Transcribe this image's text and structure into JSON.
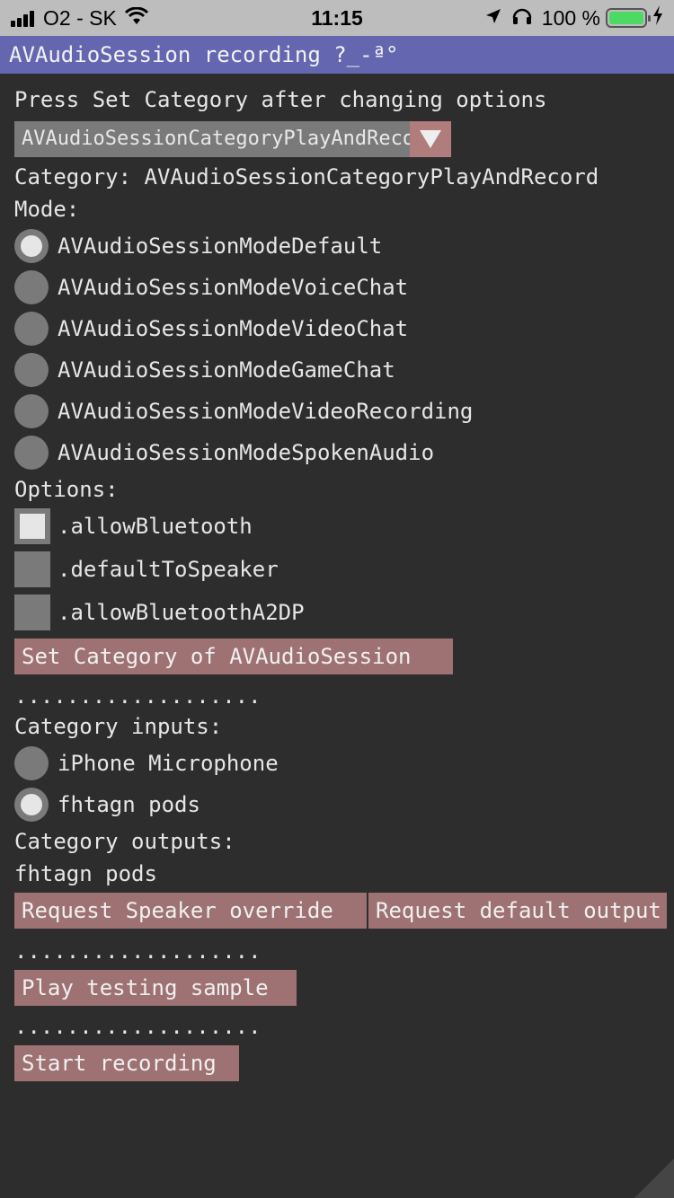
{
  "status_bar": {
    "carrier": "O2 - SK",
    "time": "11:15",
    "battery": "100 %",
    "battery_level": 1.0,
    "icons": [
      "signal-icon",
      "wifi-icon",
      "location-arrow-icon",
      "headphones-icon",
      "battery-icon",
      "charging-bolt-icon"
    ]
  },
  "window": {
    "title": "AVAudioSession recording ?_-ª°"
  },
  "main": {
    "instructions": "Press Set Category after changing options",
    "category_combo": {
      "value": "AVAudioSessionCategoryPlayAndRecord",
      "arrow_icon": "triangle-down-icon"
    },
    "category_line": "Category: AVAudioSessionCategoryPlayAndRecord",
    "mode_label": "Mode:",
    "modes": [
      {
        "label": "AVAudioSessionModeDefault",
        "selected": true
      },
      {
        "label": "AVAudioSessionModeVoiceChat",
        "selected": false
      },
      {
        "label": "AVAudioSessionModeVideoChat",
        "selected": false
      },
      {
        "label": "AVAudioSessionModeGameChat",
        "selected": false
      },
      {
        "label": "AVAudioSessionModeVideoRecording",
        "selected": false
      },
      {
        "label": "AVAudioSessionModeSpokenAudio",
        "selected": false
      }
    ],
    "options_label": "Options:",
    "options": [
      {
        "label": ".allowBluetooth",
        "checked": true
      },
      {
        "label": ".defaultToSpeaker",
        "checked": false
      },
      {
        "label": ".allowBluetoothA2DP",
        "checked": false
      }
    ],
    "set_category_button": "Set Category of AVAudioSession",
    "separator": "...................",
    "inputs_label": "Category inputs:",
    "inputs": [
      {
        "label": "iPhone Microphone",
        "selected": false
      },
      {
        "label": "fhtagn pods",
        "selected": true
      }
    ],
    "outputs_label": "Category outputs:",
    "outputs_value": "fhtagn pods",
    "request_speaker_button": "Request Speaker override",
    "request_default_button": "Request default output",
    "play_button": "Play testing sample",
    "record_button": "Start recording"
  },
  "colors": {
    "background": "#2d2d2d",
    "title_bar": "#6467b0",
    "button": "#9e7272",
    "widget": "#7a7a7a",
    "status_bar": "#bdbdbd",
    "battery_fill": "#4cd964"
  }
}
